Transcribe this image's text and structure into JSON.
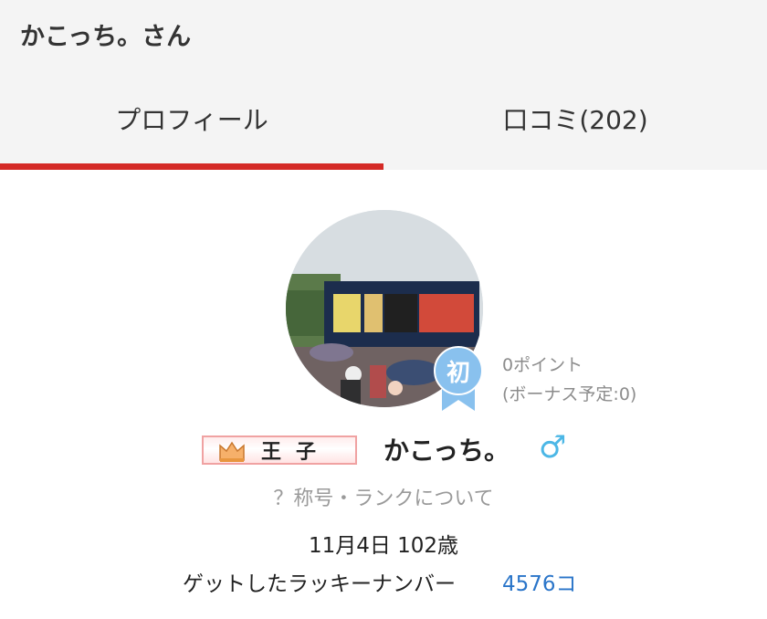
{
  "header": {
    "title": "かこっち。さん",
    "tabs": [
      {
        "label": "プロフィール",
        "active": true
      },
      {
        "label": "口コミ(202)",
        "active": false
      }
    ],
    "active_color": "#d42a26"
  },
  "profile": {
    "rank_badge": "初",
    "points": "0ポイント",
    "bonus": "(ボーナス予定:0)",
    "title_badge": "王子",
    "user_name": "かこっち。",
    "gender_symbol": "♂",
    "rank_help_link": "？称号・ランクについて",
    "birthday_age": "11月4日 102歳",
    "lucky_number_label": "ゲットしたラッキーナンバー",
    "lucky_number_value": "4576コ",
    "link_color": "#2a75c9"
  }
}
